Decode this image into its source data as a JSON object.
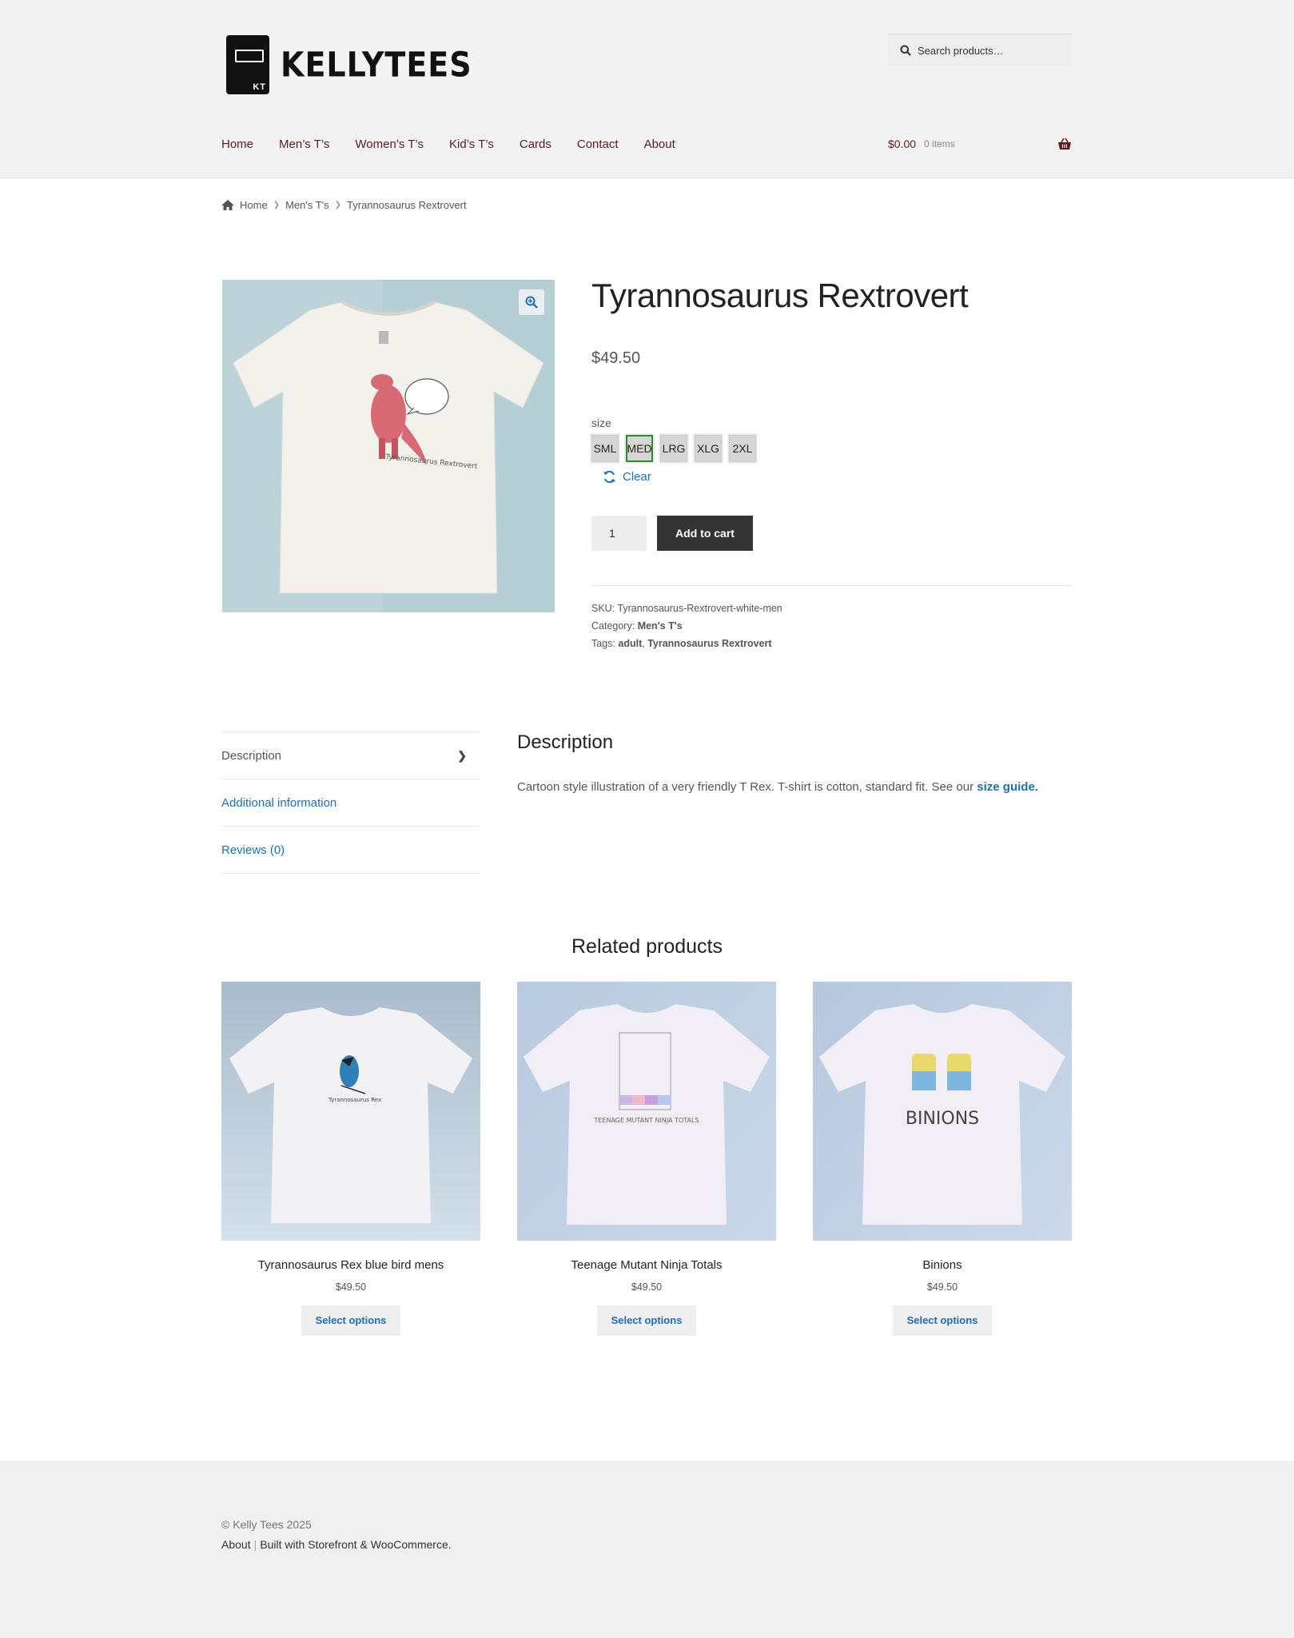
{
  "header": {
    "brand": "KELLYTEES",
    "logo_mark": "KT",
    "search_placeholder": "Search products…",
    "nav": [
      "Home",
      "Men’s T’s",
      "Women’s T’s",
      "Kid’s T’s",
      "Cards",
      "Contact",
      "About"
    ],
    "cart_amount": "$0.00",
    "cart_items": "0 items"
  },
  "breadcrumb": {
    "home": "Home",
    "category": "Men's T's",
    "current": "Tyrannosaurus Rextrovert"
  },
  "product": {
    "title": "Tyrannosaurus Rextrovert",
    "price": "$49.50",
    "size_label": "size",
    "sizes": [
      "SML",
      "MED",
      "LRG",
      "XLG",
      "2XL"
    ],
    "selected_size": "MED",
    "clear_label": "Clear",
    "quantity": "1",
    "add_to_cart": "Add to cart",
    "sku_label": "SKU:",
    "sku": "Tyrannosaurus-Rextrovert-white-men",
    "category_label": "Category:",
    "category": "Men's T's",
    "tags_label": "Tags:",
    "tags": [
      "adult",
      "Tyrannosaurus Rextrovert"
    ],
    "shirt_print_text": "Tyrannosaurus Rextrovert"
  },
  "tabs": {
    "items": [
      "Description",
      "Additional information",
      "Reviews (0)"
    ],
    "active": "Description",
    "description_title": "Description",
    "description_text": "Cartoon style illustration of a very friendly T Rex. T-shirt is cotton, standard fit. See our ",
    "description_link": "size guide."
  },
  "related": {
    "title": "Related products",
    "products": [
      {
        "name": "Tyrannosaurus Rex blue bird mens",
        "price": "$49.50",
        "button": "Select options"
      },
      {
        "name": "Teenage Mutant Ninja Totals",
        "price": "$49.50",
        "button": "Select options"
      },
      {
        "name": "Binions",
        "price": "$49.50",
        "button": "Select options"
      }
    ],
    "print_labels": [
      "Tyrannosaurus Rex",
      "TEENAGE MUTANT NINJA TOTALS",
      "BINIONS"
    ]
  },
  "footer": {
    "copyright": "© Kelly Tees 2025",
    "links": [
      "About",
      "Built with Storefront & WooCommerce"
    ],
    "period": "."
  },
  "colors": {
    "nav": "#5c1b1b",
    "link": "#1d6fb8",
    "button_dark": "#333333",
    "selected_size_border": "#2f8a2f"
  },
  "icons": [
    "search-icon",
    "basket-icon",
    "home-icon",
    "zoom-icon",
    "refresh-icon",
    "chevron-right-icon"
  ]
}
